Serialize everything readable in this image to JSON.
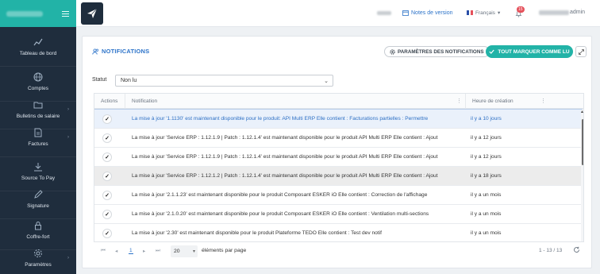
{
  "sidebar": {
    "items": [
      {
        "label": "Tableau de bord",
        "icon": "chart-icon"
      },
      {
        "label": "Comptes",
        "icon": "globe-icon"
      },
      {
        "label": "Bulletins de salaire",
        "icon": "folder-icon"
      },
      {
        "label": "Factures",
        "icon": "invoice-icon"
      },
      {
        "label": "Source To Pay",
        "icon": "download-icon"
      },
      {
        "label": "Signature",
        "icon": "pen-icon"
      },
      {
        "label": "Coffre-fort",
        "icon": "lock-icon"
      },
      {
        "label": "Paramètres",
        "icon": "gear-icon"
      }
    ]
  },
  "topbar": {
    "notes_label": "Notes de version",
    "language": "Français",
    "notif_count": "15",
    "user_suffix": "admin"
  },
  "page": {
    "title": "NOTIFICATIONS",
    "params_button": "PARAMÈTRES DES NOTIFICATIONS",
    "mark_all_button": "TOUT MARQUER COMME LU",
    "statut_label": "Statut",
    "statut_value": "Non lu"
  },
  "table": {
    "headers": {
      "actions": "Actions",
      "notification": "Notification",
      "created": "Heure de création"
    },
    "rows": [
      {
        "message": "La mise à jour '1.1130' est maintenant disponible pour le produit: API Multi ERP Elle contient : Facturations partielles : Permettre",
        "time": "il y a 10 jours"
      },
      {
        "message": "La mise à jour 'Service ERP : 1.12.1.9 | Patch : 1.12.1.4' est maintenant disponible pour le produit API Multi ERP Elle contient : Ajout",
        "time": "il y a 12 jours"
      },
      {
        "message": "La mise à jour 'Service ERP : 1.12.1.9 | Patch : 1.12.1.4' est maintenant disponible pour le produit API Multi ERP Elle contient : Ajout",
        "time": "il y a 12 jours"
      },
      {
        "message": "La mise à jour 'Service ERP : 1.12.1.2 | Patch : 1.12.1.4' est maintenant disponible pour le produit API Multi ERP Elle contient : Ajout",
        "time": "il y a 18 jours"
      },
      {
        "message": "La mise à jour '2.1.1.23' est maintenant disponible pour le produit Composant ESKER iO Elle contient : Correction de l'affichage",
        "time": "il y a un mois"
      },
      {
        "message": "La mise à jour '2.1.0.20' est maintenant disponible pour le produit Composant ESKER iO Elle contient : Ventilation multi-sections",
        "time": "il y a un mois"
      },
      {
        "message": "La mise à jour '2.30' est maintenant disponible pour le produit Plateforme TEDO Elle contient : Test dev notif",
        "time": "il y a un mois"
      }
    ]
  },
  "pager": {
    "current_page": "1",
    "page_size": "20",
    "per_page_label": "éléments par page",
    "count": "1 - 13 / 13"
  },
  "colors": {
    "sidebar_bg": "#1f2d3d",
    "accent": "#22b3a7",
    "link_blue": "#2c73c9",
    "badge_red": "#e5515b"
  }
}
